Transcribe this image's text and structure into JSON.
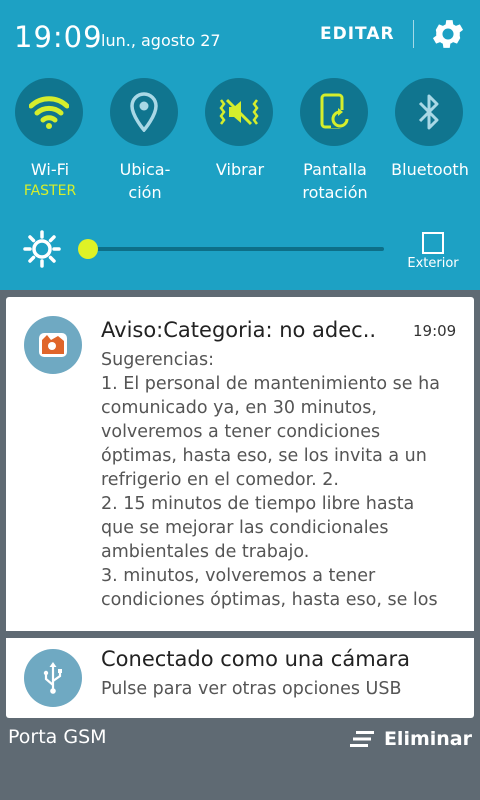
{
  "status": {
    "time": "19:09",
    "date": "lun., agosto 27",
    "edit_label": "EDITAR"
  },
  "quick_settings": [
    {
      "label_line1": "Wi-Fi",
      "label_line2": "",
      "sub": "FASTER",
      "icon": "wifi-icon",
      "active": true
    },
    {
      "label_line1": "Ubica-",
      "label_line2": "ción",
      "sub": "",
      "icon": "location-icon",
      "active": false
    },
    {
      "label_line1": "Vibrar",
      "label_line2": "",
      "sub": "",
      "icon": "vibrate-icon",
      "active": true
    },
    {
      "label_line1": "Pantalla",
      "label_line2": "rotación",
      "sub": "",
      "icon": "screen-rotation-icon",
      "active": true
    },
    {
      "label_line1": "Bluetooth",
      "label_line2": "",
      "sub": "",
      "icon": "bluetooth-icon",
      "active": false
    }
  ],
  "brightness": {
    "level": 0.0,
    "outdoor_label": "Exterior"
  },
  "notifications": [
    {
      "title": "Aviso:Categoria: no adec..",
      "time": "19:09",
      "body_lines": [
        "Sugerencias:",
        "1. El personal de mantenimiento se ha",
        "comunicado ya, en 30 minutos,",
        "volveremos a tener condiciones",
        "óptimas, hasta eso, se los invita a un",
        "refrigerio en el comedor.  2.",
        "2. 15 minutos de tiempo libre hasta",
        "que se mejorar las condicionales",
        "ambientales de trabajo.",
        "3.  minutos, volveremos a tener",
        "condiciones óptimas, hasta eso, se los"
      ]
    },
    {
      "title": "Conectado como una cámara",
      "subtitle": "Pulse para ver otras opciones USB"
    }
  ],
  "footer": {
    "carrier": "Porta GSM",
    "clear_label": "Eliminar"
  },
  "colors": {
    "panel": "#1da1c4",
    "toggle_bg": "#10758f",
    "active": "#d5ee2c",
    "inactive": "#a9d8e6"
  }
}
